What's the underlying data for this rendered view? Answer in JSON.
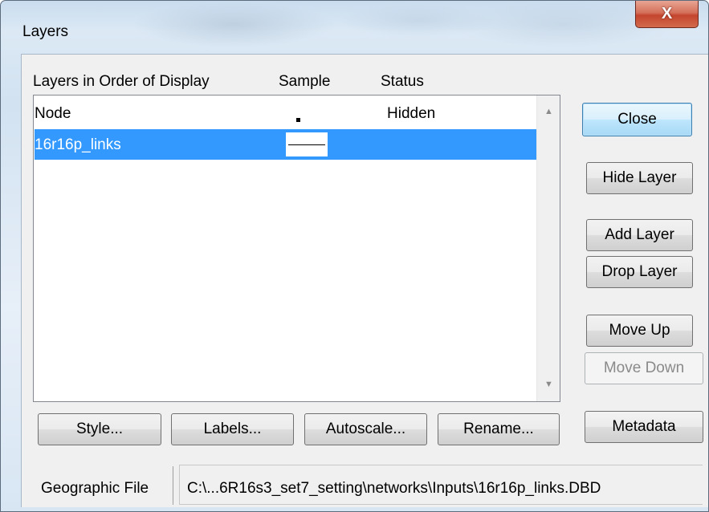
{
  "window": {
    "title": "Layers",
    "close_glyph": "X"
  },
  "list": {
    "headers": {
      "layers": "Layers in Order of Display",
      "sample": "Sample",
      "status": "Status"
    },
    "rows": [
      {
        "name": "Node",
        "sample": "point",
        "status": "Hidden",
        "selected": false
      },
      {
        "name": "16r16p_links",
        "sample": "line",
        "status": "",
        "selected": true
      }
    ],
    "scroll_up_icon": "▲",
    "scroll_down_icon": "▼"
  },
  "buttons": {
    "close": "Close",
    "hide_layer": "Hide Layer",
    "add_layer": "Add Layer",
    "drop_layer": "Drop Layer",
    "move_up": "Move Up",
    "move_down": "Move Down",
    "style": "Style...",
    "labels": "Labels...",
    "autoscale": "Autoscale...",
    "rename": "Rename...",
    "metadata": "Metadata"
  },
  "footer": {
    "label": "Geographic File",
    "value": "C:\\...6R16s3_set7_setting\\networks\\Inputs\\16r16p_links.DBD"
  },
  "colors": {
    "selection": "#3399ff",
    "close_button": "#c4452e"
  }
}
